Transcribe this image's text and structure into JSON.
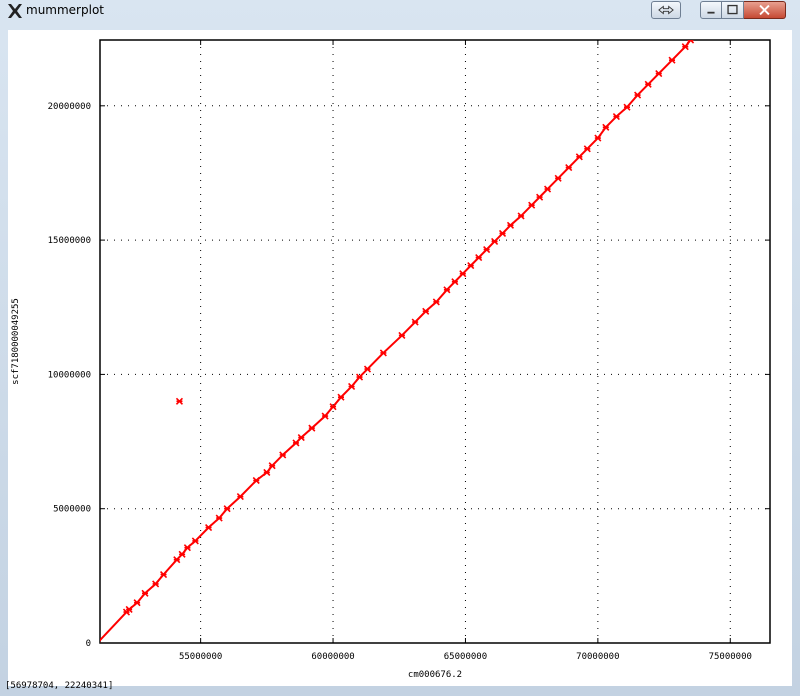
{
  "window": {
    "title": "mummerplot",
    "icon": "x11-icon",
    "controls": [
      "resize-icon",
      "minimize-icon",
      "maximize-icon",
      "close-icon"
    ]
  },
  "status": {
    "coordinates": "[56978704, 22240341]"
  },
  "colors": {
    "series": "#ff0000",
    "grid": "#000000",
    "background": "#ffffff"
  },
  "chart_data": {
    "type": "scatter",
    "title": "",
    "xlabel": "cm000676.2",
    "ylabel": "scf7180000049255",
    "xlim": [
      51200000,
      76500000
    ],
    "ylim": [
      0,
      22450000
    ],
    "x_ticks": [
      55000000,
      60000000,
      65000000,
      70000000,
      75000000
    ],
    "y_ticks": [
      0,
      5000000,
      10000000,
      15000000,
      20000000
    ],
    "x_tick_labels": [
      "55000000",
      "60000000",
      "65000000",
      "70000000",
      "75000000"
    ],
    "y_tick_labels": [
      "0",
      "5000000",
      "10000000",
      "15000000",
      "20000000"
    ],
    "grid": true,
    "series": [
      {
        "color": "#ff0000",
        "connected": true,
        "points": [
          [
            51100000,
            0
          ],
          [
            52200000,
            1150000
          ],
          [
            52300000,
            1250000
          ],
          [
            52600000,
            1500000
          ],
          [
            52900000,
            1850000
          ],
          [
            53300000,
            2200000
          ],
          [
            53600000,
            2550000
          ],
          [
            54100000,
            3100000
          ],
          [
            54300000,
            3300000
          ],
          [
            54500000,
            3550000
          ],
          [
            54800000,
            3800000
          ],
          [
            55300000,
            4300000
          ],
          [
            55700000,
            4650000
          ],
          [
            56000000,
            5000000
          ],
          [
            56500000,
            5450000
          ],
          [
            57100000,
            6050000
          ],
          [
            57500000,
            6350000
          ],
          [
            57700000,
            6600000
          ],
          [
            58100000,
            7000000
          ],
          [
            58600000,
            7450000
          ],
          [
            58800000,
            7650000
          ],
          [
            59200000,
            8000000
          ],
          [
            59700000,
            8450000
          ],
          [
            60000000,
            8800000
          ],
          [
            60300000,
            9150000
          ],
          [
            60700000,
            9550000
          ],
          [
            61000000,
            9900000
          ],
          [
            61300000,
            10200000
          ],
          [
            61900000,
            10800000
          ],
          [
            62600000,
            11450000
          ],
          [
            63100000,
            11950000
          ],
          [
            63500000,
            12350000
          ],
          [
            63900000,
            12700000
          ],
          [
            64300000,
            13150000
          ],
          [
            64600000,
            13450000
          ],
          [
            64900000,
            13750000
          ],
          [
            65200000,
            14050000
          ],
          [
            65500000,
            14350000
          ],
          [
            65800000,
            14650000
          ],
          [
            66100000,
            14950000
          ],
          [
            66400000,
            15250000
          ],
          [
            66700000,
            15550000
          ],
          [
            67100000,
            15900000
          ],
          [
            67500000,
            16300000
          ],
          [
            67800000,
            16600000
          ],
          [
            68100000,
            16900000
          ],
          [
            68500000,
            17300000
          ],
          [
            68900000,
            17700000
          ],
          [
            69300000,
            18100000
          ],
          [
            69600000,
            18400000
          ],
          [
            70000000,
            18800000
          ],
          [
            70300000,
            19200000
          ],
          [
            70700000,
            19600000
          ],
          [
            71100000,
            19950000
          ],
          [
            71500000,
            20400000
          ],
          [
            71900000,
            20800000
          ],
          [
            72300000,
            21200000
          ],
          [
            72800000,
            21700000
          ],
          [
            73300000,
            22200000
          ],
          [
            73500000,
            22450000
          ]
        ]
      },
      {
        "color": "#ff0000",
        "connected": false,
        "points": [
          [
            54200000,
            9000000
          ]
        ]
      }
    ]
  }
}
